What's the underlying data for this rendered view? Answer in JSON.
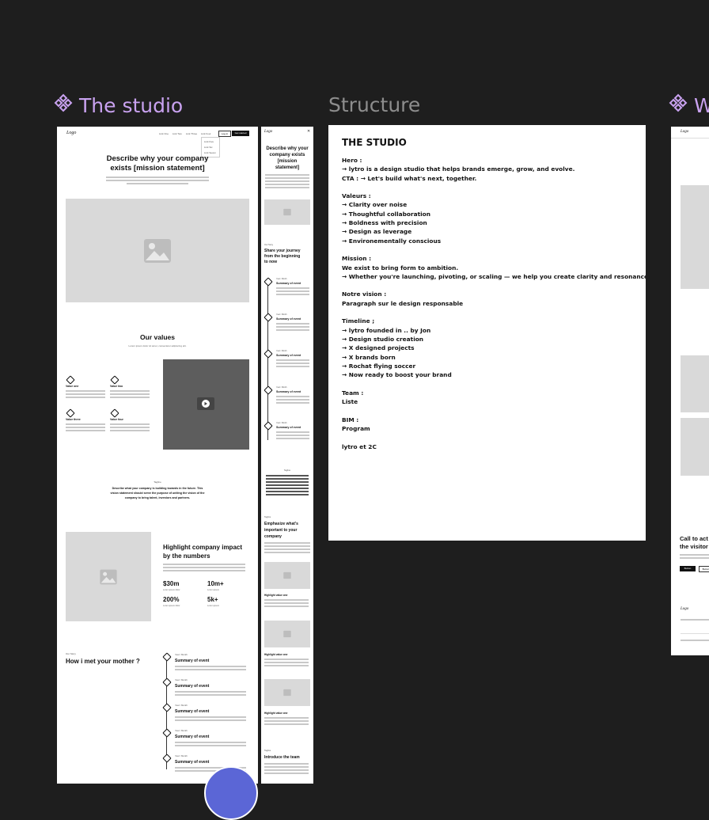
{
  "frames": {
    "studio_label": "The studio",
    "structure_label": "Structure",
    "third_label": "W"
  },
  "studio": {
    "logo": "Logo",
    "nav": [
      "Link One",
      "Link Two",
      "Link Three",
      "Link Four"
    ],
    "nav_btn": "Log in",
    "nav_cta": "Get started",
    "dropdown": [
      "Link Five",
      "Link Six",
      "Link Seven"
    ],
    "hero_title_1": "Describe why your company",
    "hero_title_2": "exists [mission statement]",
    "values_title": "Our values",
    "values_sub": "Lorem ipsum dolor sit amet, consectetur adipiscing elit.",
    "values": [
      "Value one",
      "Value two",
      "Value three",
      "Value four"
    ],
    "vision_tag": "Tagline",
    "vision_text_1": "Describe what your company is building towards in the future. This",
    "vision_text_2": "vision statement should serve the purpose of uniting the vision of the",
    "vision_text_3": "company to bring talent, investors and partners.",
    "impact_title_1": "Highlight company impact",
    "impact_title_2": "by the numbers",
    "stats": [
      {
        "value": "$30m",
        "label": "Lorem ipsum dolor"
      },
      {
        "value": "10m+",
        "label": "Lorem ipsum"
      },
      {
        "value": "200%",
        "label": "Lorem ipsum dolor"
      },
      {
        "value": "5k+",
        "label": "Lorem ipsum"
      }
    ],
    "story_tag": "Our Story",
    "story_title": "How i met your mother ?",
    "timeline_date": "Year / Month",
    "timeline_item": "Summary of event"
  },
  "mobile": {
    "logo": "Logo",
    "hero_title_1": "Describe why your",
    "hero_title_2": "company exists",
    "hero_title_3": "[mission",
    "hero_title_4": "statement]",
    "journey_tag": "Our Story",
    "journey_1": "Share your journey",
    "journey_2": "from the beginning",
    "journey_3": "to now",
    "event": "Summary of event",
    "event_date": "Year / Month",
    "vision_tag": "Tagline",
    "emph_1": "Emphasize what's",
    "emph_2": "important to your",
    "emph_3": "company",
    "tag2": "Tagline",
    "h1": "Highlight value one",
    "h2": "Highlight value one",
    "h3": "Highlight value one",
    "team": "Introduce the team"
  },
  "structure": {
    "title": "THE STUDIO",
    "lines": [
      "Hero :",
      "→ lytro is a design studio that helps brands emerge, grow, and evolve.",
      "CTA : → Let's build what's next, together.",
      "",
      "Valeurs :",
      "→ Clarity over noise",
      "→ Thoughtful collaboration",
      "→ Boldness with precision",
      "→ Design as leverage",
      "→ Environementally conscious",
      "",
      "Mission :",
      "We exist to bring form to ambition.",
      " → Whether you're launching, pivoting, or scaling — we help you create clarity and resonance through design.",
      "",
      "Notre vision :",
      "Paragraph sur le design responsable",
      "",
      "Timeline ;",
      "→ lytro founded in .. by Jon",
      "→ Design studio creation",
      "→ X designed projects",
      "→ X brands born",
      "→ Rochat flying soccer",
      "→ Now ready to boost your brand",
      "",
      "Team :",
      "Liste",
      "",
      "BIM :",
      "Program",
      "",
      "lytro et 2C"
    ]
  },
  "third": {
    "cta_1": "Call to act",
    "cta_2": "the visitor",
    "btn1": "Button",
    "btn2": "Button",
    "logo": "Logo"
  },
  "colors": {
    "canvas": "#1e1e1e",
    "component_label": "#c9a2f0",
    "plain_label": "#8d8d8d"
  }
}
